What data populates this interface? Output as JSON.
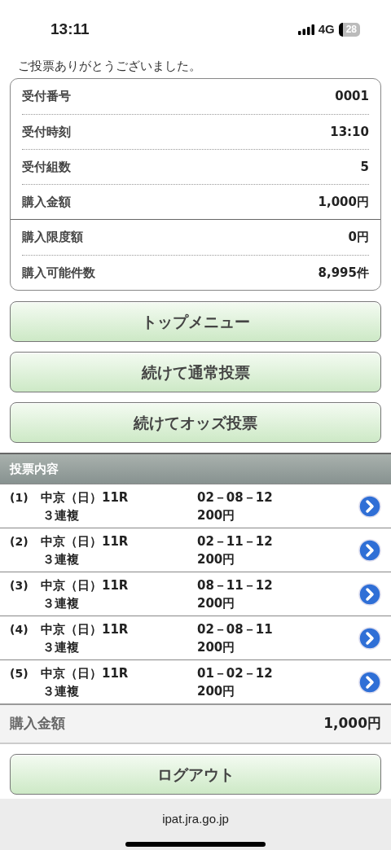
{
  "status_bar": {
    "time": "13:11",
    "network": "4G",
    "battery": "28"
  },
  "message": "ご投票ありがとうございました。",
  "receipt": {
    "groups": [
      [
        {
          "label": "受付番号",
          "value": "0001"
        },
        {
          "label": "受付時刻",
          "value": "13:10"
        },
        {
          "label": "受付組数",
          "value": "5"
        },
        {
          "label": "購入金額",
          "value": "1,000円"
        }
      ],
      [
        {
          "label": "購入限度額",
          "value": "0円"
        },
        {
          "label": "購入可能件数",
          "value": "8,995件"
        }
      ]
    ]
  },
  "buttons": [
    "トップメニュー",
    "続けて通常投票",
    "続けてオッズ投票"
  ],
  "bets": {
    "title": "投票内容",
    "items": [
      {
        "no": "(1)",
        "race": "中京（日）11R",
        "type": "３連複",
        "combo": "02－08－12",
        "amount": "200円"
      },
      {
        "no": "(2)",
        "race": "中京（日）11R",
        "type": "３連複",
        "combo": "02－11－12",
        "amount": "200円"
      },
      {
        "no": "(3)",
        "race": "中京（日）11R",
        "type": "３連複",
        "combo": "08－11－12",
        "amount": "200円"
      },
      {
        "no": "(4)",
        "race": "中京（日）11R",
        "type": "３連複",
        "combo": "02－08－11",
        "amount": "200円"
      },
      {
        "no": "(5)",
        "race": "中京（日）11R",
        "type": "３連複",
        "combo": "01－02－12",
        "amount": "200円"
      }
    ]
  },
  "total": {
    "label": "購入金額",
    "value": "1,000円"
  },
  "logout": "ログアウト",
  "url": "ipat.jra.go.jp"
}
